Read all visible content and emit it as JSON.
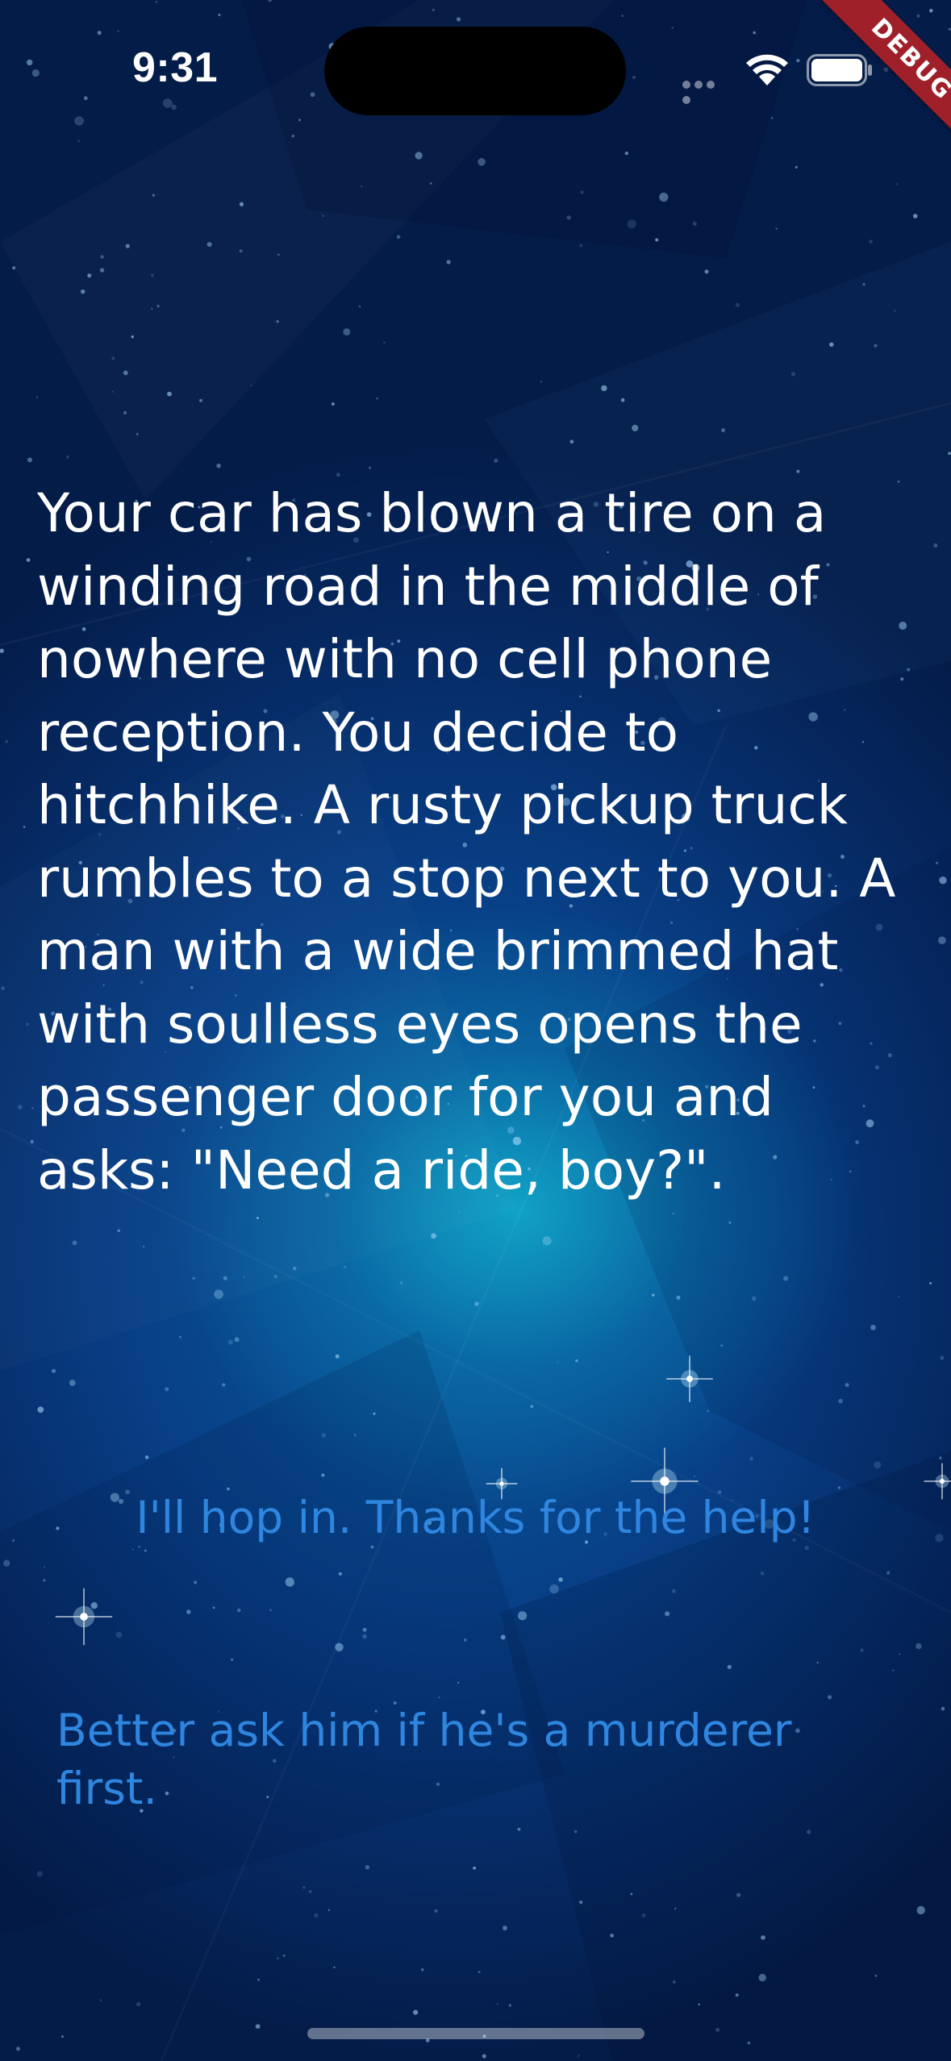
{
  "status_bar": {
    "time": "9:31",
    "icons": [
      "signal-dots-icon",
      "wifi-icon",
      "battery-icon"
    ]
  },
  "debug_banner": {
    "label": "DEBUG",
    "color": "#a0202a"
  },
  "story": {
    "text": "Your car has blown a tire on a winding road in the middle of nowhere with no cell phone reception. You decide to hitchhike. A rusty pickup truck rumbles to a stop next to you. A man with a wide brimmed hat with soulless eyes opens the passenger door for you and asks: \"Need a ride, boy?\"."
  },
  "choices": {
    "choice1": "I'll hop in. Thanks for the help!",
    "choice2": "Better ask him if he's a murderer first."
  },
  "colors": {
    "choice_text": "#2f86e0",
    "story_text": "#ffffff",
    "background_deep": "#062a64",
    "background_glow": "#12afcd"
  }
}
